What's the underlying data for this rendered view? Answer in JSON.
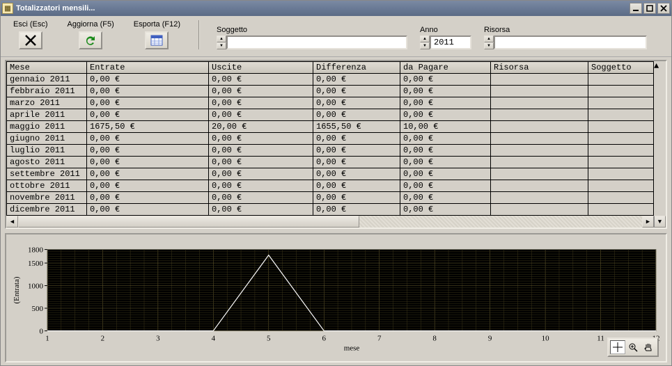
{
  "window": {
    "title": "Totalizzatori mensili..."
  },
  "toolbar": {
    "exit": "Esci (Esc)",
    "refresh": "Aggiorna (F5)",
    "export": "Esporta (F12)"
  },
  "filters": {
    "subject": {
      "label": "Soggetto",
      "value": ""
    },
    "year": {
      "label": "Anno",
      "value": "2011"
    },
    "resource": {
      "label": "Risorsa",
      "value": ""
    }
  },
  "table": {
    "columns": [
      "Mese",
      "Entrate",
      "Uscite",
      "Differenza",
      "da Pagare",
      "Risorsa",
      "Soggetto"
    ],
    "rows": [
      {
        "mese": "gennaio 2011",
        "entrate": "0,00 €",
        "uscite": "0,00 €",
        "diff": "0,00 €",
        "pagare": "0,00 €",
        "risorsa": "",
        "soggetto": ""
      },
      {
        "mese": "febbraio 2011",
        "entrate": "0,00 €",
        "uscite": "0,00 €",
        "diff": "0,00 €",
        "pagare": "0,00 €",
        "risorsa": "",
        "soggetto": ""
      },
      {
        "mese": "marzo 2011",
        "entrate": "0,00 €",
        "uscite": "0,00 €",
        "diff": "0,00 €",
        "pagare": "0,00 €",
        "risorsa": "",
        "soggetto": ""
      },
      {
        "mese": "aprile 2011",
        "entrate": "0,00 €",
        "uscite": "0,00 €",
        "diff": "0,00 €",
        "pagare": "0,00 €",
        "risorsa": "",
        "soggetto": ""
      },
      {
        "mese": "maggio 2011",
        "entrate": "1675,50 €",
        "uscite": "20,00 €",
        "diff": "1655,50 €",
        "pagare": "10,00 €",
        "risorsa": "",
        "soggetto": ""
      },
      {
        "mese": "giugno 2011",
        "entrate": "0,00 €",
        "uscite": "0,00 €",
        "diff": "0,00 €",
        "pagare": "0,00 €",
        "risorsa": "",
        "soggetto": ""
      },
      {
        "mese": "luglio 2011",
        "entrate": "0,00 €",
        "uscite": "0,00 €",
        "diff": "0,00 €",
        "pagare": "0,00 €",
        "risorsa": "",
        "soggetto": ""
      },
      {
        "mese": "agosto 2011",
        "entrate": "0,00 €",
        "uscite": "0,00 €",
        "diff": "0,00 €",
        "pagare": "0,00 €",
        "risorsa": "",
        "soggetto": ""
      },
      {
        "mese": "settembre 2011",
        "entrate": "0,00 €",
        "uscite": "0,00 €",
        "diff": "0,00 €",
        "pagare": "0,00 €",
        "risorsa": "",
        "soggetto": ""
      },
      {
        "mese": "ottobre 2011",
        "entrate": "0,00 €",
        "uscite": "0,00 €",
        "diff": "0,00 €",
        "pagare": "0,00 €",
        "risorsa": "",
        "soggetto": ""
      },
      {
        "mese": "novembre 2011",
        "entrate": "0,00 €",
        "uscite": "0,00 €",
        "diff": "0,00 €",
        "pagare": "0,00 €",
        "risorsa": "",
        "soggetto": ""
      },
      {
        "mese": "dicembre 2011",
        "entrate": "0,00 €",
        "uscite": "0,00 €",
        "diff": "0,00 €",
        "pagare": "0,00 €",
        "risorsa": "",
        "soggetto": ""
      }
    ]
  },
  "chart_data": {
    "type": "line",
    "xlabel": "mese",
    "ylabel": "(Entrata)",
    "y_ticks": [
      0,
      500,
      1000,
      1500,
      1800
    ],
    "x_ticks": [
      1,
      2,
      3,
      4,
      5,
      6,
      7,
      8,
      9,
      10,
      11,
      12
    ],
    "ylim": [
      0,
      1800
    ],
    "xlim": [
      1,
      12
    ],
    "series": [
      {
        "name": "Entrata",
        "x": [
          1,
          2,
          3,
          4,
          5,
          6,
          7,
          8,
          9,
          10,
          11,
          12
        ],
        "y": [
          0,
          0,
          0,
          0,
          1675.5,
          0,
          0,
          0,
          0,
          0,
          0,
          0
        ],
        "color": "#ffffff"
      }
    ],
    "grid": true,
    "background": "#000000"
  }
}
